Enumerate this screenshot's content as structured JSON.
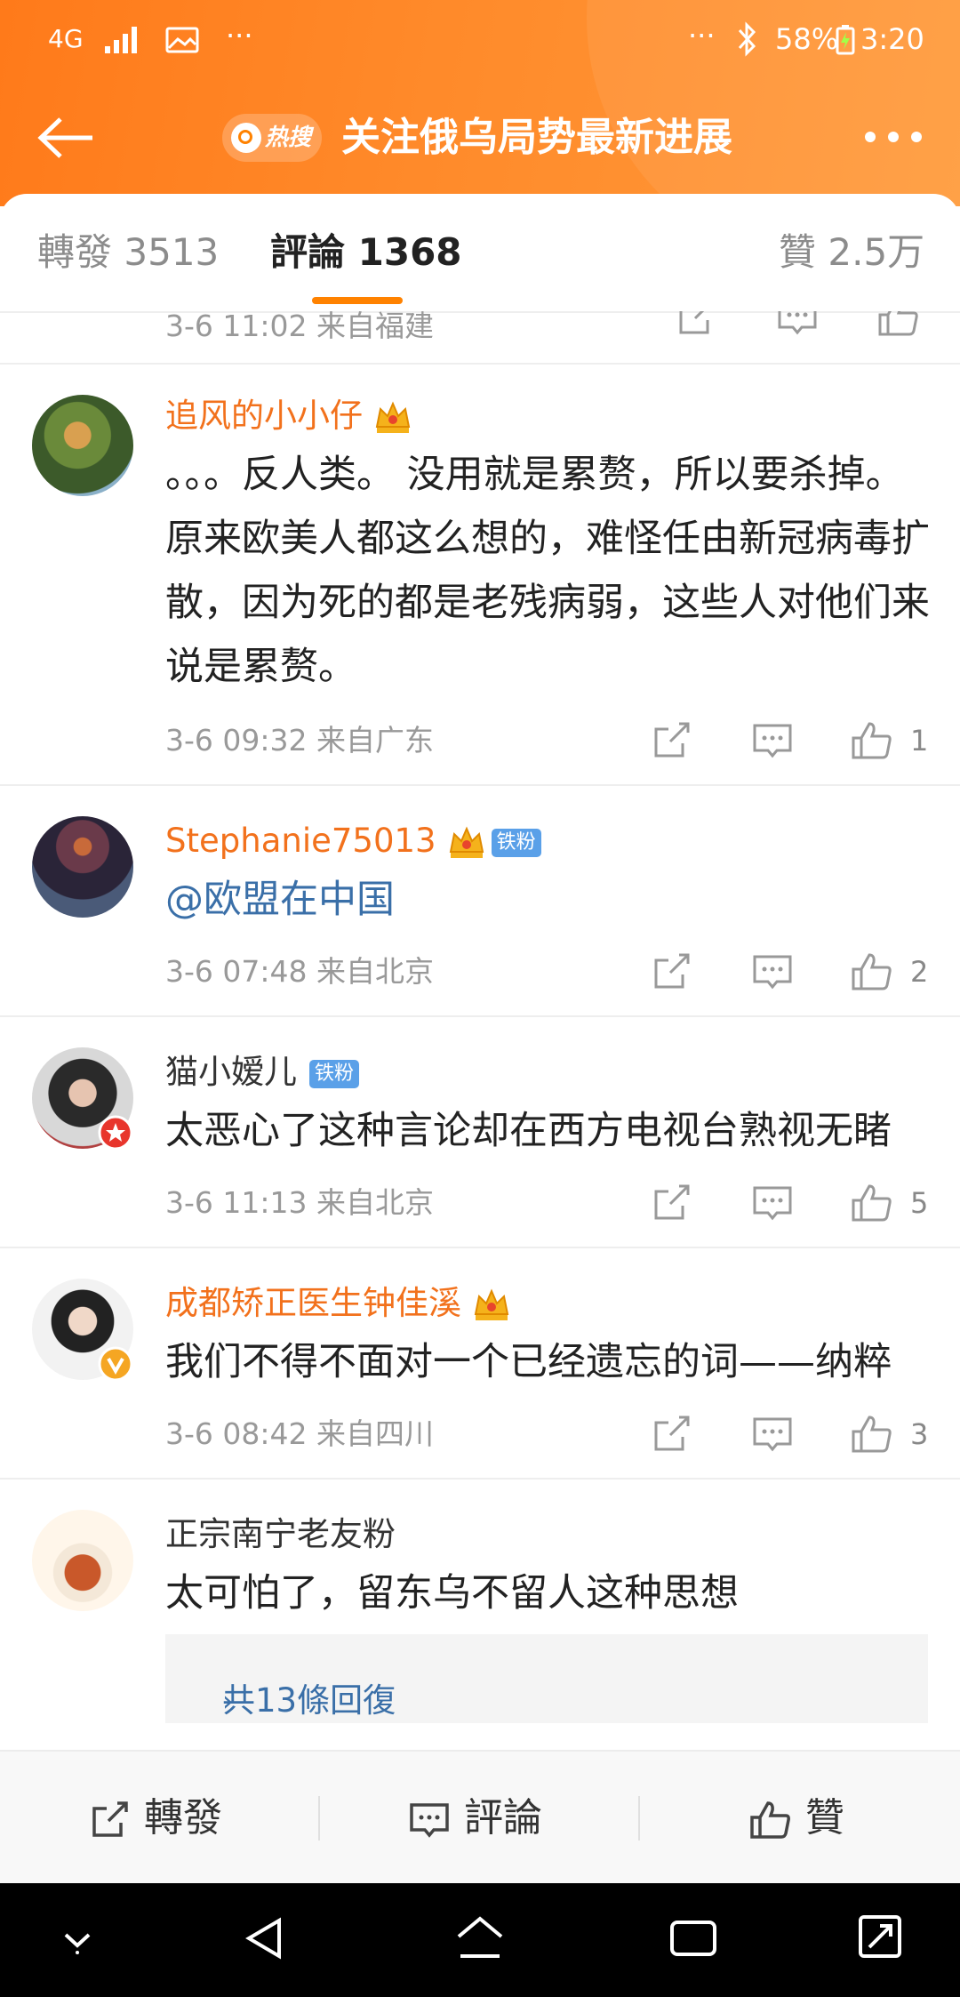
{
  "status_bar": {
    "network": "4G",
    "misc": "···",
    "battery": "58%",
    "time": "3:20"
  },
  "header": {
    "back_icon": "arrow-left-icon",
    "hot_badge": "热搜",
    "title": "关注俄乌局势最新进展",
    "more_icon": "more-dots-icon"
  },
  "tabs": {
    "reposts_label": "轉發",
    "reposts_count": "3513",
    "comments_label": "評論",
    "comments_count": "1368",
    "likes_label": "贊",
    "likes_count": "2.5万"
  },
  "partial_comment": {
    "meta": "3-6 11:02 来自福建"
  },
  "comments": [
    {
      "user": "追风的小小仔",
      "vip": "6",
      "text": "。。。反人类。 没用就是累赘，所以要杀掉。 原来欧美人都这么想的，难怪任由新冠病毒扩散，因为死的都是老残病弱，这些人对他们来说是累赘。",
      "meta": "3-6 09:32 来自广东",
      "likes": "1"
    },
    {
      "user": "Stephanie75013",
      "vip": "6",
      "fan_badge": "铁粉",
      "text": "@欧盟在中国",
      "meta": "3-6 07:48 来自北京",
      "likes": "2"
    },
    {
      "user": "猫小嫒儿",
      "fan_badge": "铁粉",
      "text": "太恶心了这种言论却在西方电视台熟视无睹",
      "meta": "3-6 11:13 来自北京",
      "likes": "5"
    },
    {
      "user": "成都矫正医生钟佳溪",
      "text": "我们不得不面对一个已经遗忘的词——纳粹",
      "meta": "3-6 08:42 来自四川",
      "likes": "3"
    },
    {
      "user": "正宗南宁老友粉",
      "text": "太可怕了，留东乌不留人这种思想",
      "replies": "共13條回復"
    }
  ],
  "bottom_bar": {
    "repost": "轉發",
    "comment": "評論",
    "like": "贊"
  },
  "colors": {
    "accent": "#ff8200",
    "vip_name": "#f2711c",
    "link": "#3a6fa8"
  }
}
